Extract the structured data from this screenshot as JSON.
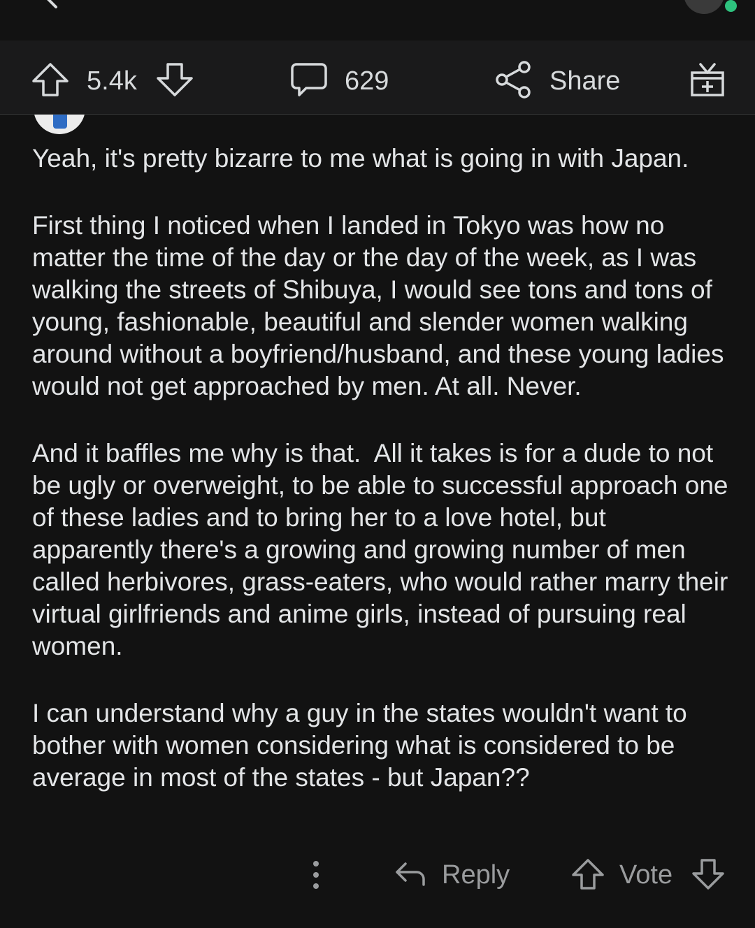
{
  "action_bar": {
    "upvotes": "5.4k",
    "comments": "629",
    "share_label": "Share"
  },
  "comment": {
    "author": "",
    "paragraphs": [
      "Yeah, it's pretty bizarre to me what is going in with Japan.",
      "First thing I noticed when I landed in Tokyo was how no matter the time of the day or the day of the week, as I was walking the streets of Shibuya, I would see tons and tons of young, fashionable, beautiful and slender women walking around without a boyfriend/husband, and these young ladies would not get approached by men. At all. Never.",
      "And it baffles me why is that.  All it takes is for a dude to not be ugly or overweight, to be able to successful approach one of these ladies and to bring her to a love hotel, but apparently there's a growing and growing number of men called herbivores, grass-eaters, who would rather marry their virtual girlfriends and anime girls, instead of pursuing real women.",
      "I can understand why a guy in the states wouldn't want to bother with women considering what is considered to be average in most of the states - but Japan??"
    ]
  },
  "bottom_actions": {
    "reply_label": "Reply",
    "vote_label": "Vote"
  },
  "colors": {
    "background": "#121212",
    "bar_background": "#1a1a1b",
    "text": "#d7dadc",
    "muted": "#9a9c9e",
    "online": "#2ec27e"
  },
  "icons": [
    "back-arrow-icon",
    "upvote-icon",
    "downvote-icon",
    "comment-icon",
    "share-icon",
    "award-icon",
    "more-icon",
    "reply-icon"
  ]
}
